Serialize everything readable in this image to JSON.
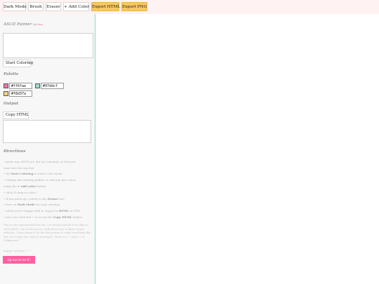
{
  "toolbar": {
    "dark_mode": "Dark Mode",
    "brush": "Brush",
    "eraser": "Eraser",
    "add_color": "+ Add Color",
    "export_html": "Export HTML",
    "export_png": "Export PNG"
  },
  "sidebar": {
    "title": "ASCII Painter",
    "by": "by",
    "author": "tina",
    "ascii_input": {
      "value": "",
      "placeholder": ""
    },
    "start_button": "Start Coloring",
    "palette_label": "Palette",
    "palette": [
      {
        "hex": "#ff6fae"
      },
      {
        "hex": "#97ddcf"
      },
      {
        "hex": "#f8d37a"
      }
    ],
    "output_label": "Output",
    "copy_button": "Copy HTML",
    "output_value": "",
    "directions_label": "Directions",
    "directions": [
      {
        "pre": "• paste any ASCII art, dot art, kaomoji, or text you",
        "bold": "",
        "post": ""
      },
      {
        "pre": "want into the top box",
        "bold": "",
        "post": ""
      },
      {
        "pre": "• hit ",
        "bold": "Start Coloring",
        "post": " to enter color mode"
      },
      {
        "pre": "• change the existing pallete or add any hex colors",
        "bold": "",
        "post": ""
      },
      {
        "pre": "using the ",
        "bold": "+ add color",
        "post": " button"
      },
      {
        "pre": "• click & drag to color!",
        "bold": "",
        "post": ""
      },
      {
        "pre": "• if you mess up, switch to the ",
        "bold": "Eraser",
        "post": " tool"
      },
      {
        "pre": "• turn on ",
        "bold": "Dark Mode",
        "post": " for easy viewing!"
      },
      {
        "pre": "• when you're happy with it, export as ",
        "bold": "HTML",
        "post": " or PNG"
      },
      {
        "pre": "• you can Ctrl/Cmd + A or use the ",
        "bold": "Copy HTML",
        "post": " button"
      }
    ],
    "note": "This is very experimental for me! I've always wanted to be able to color ASCII / dot art but never really knew how or knew of any websites. I don't know if I'm the first person to make something like this, but I hope you enjoy it anyway(s)! *there is a ♡ and a ☆ in helping me!",
    "happy": "happy coloring ~ ♡",
    "tip_button": "tip me on ko-fi!"
  },
  "colors": {
    "accent_pink": "#ff5ea0",
    "export_yellow": "#f8c766",
    "divider_teal": "#8dd6c8"
  }
}
